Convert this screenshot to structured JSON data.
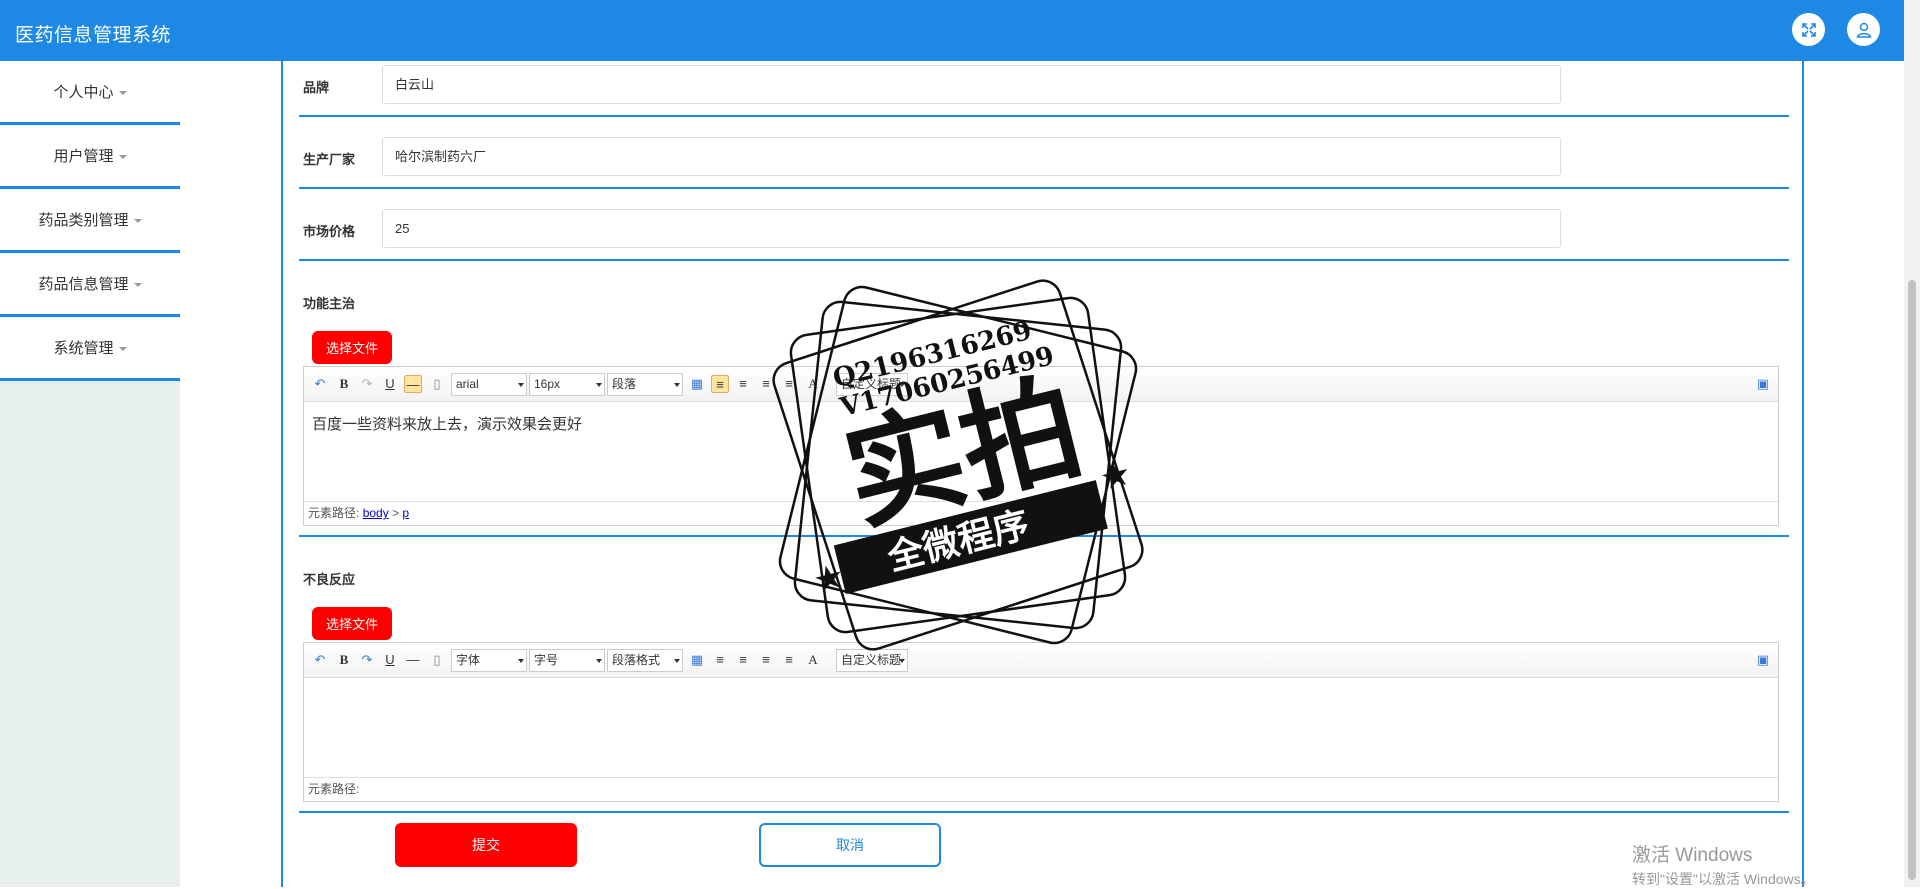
{
  "app": {
    "title": "医药信息管理系统"
  },
  "header": {
    "fullscreen_icon": "fullscreen-icon",
    "user_icon": "user-icon"
  },
  "sidebar": {
    "items": [
      {
        "label": "个人中心"
      },
      {
        "label": "用户管理"
      },
      {
        "label": "药品类别管理"
      },
      {
        "label": "药品信息管理"
      },
      {
        "label": "系统管理"
      }
    ]
  },
  "form": {
    "brand": {
      "label": "品牌",
      "value": "白云山"
    },
    "manufacturer": {
      "label": "生产厂家",
      "value": "哈尔滨制药六厂"
    },
    "price": {
      "label": "市场价格",
      "value": "25"
    },
    "functions": {
      "label": "功能主治",
      "file_button": "选择文件",
      "toolbar": {
        "font": "arial",
        "size": "16px",
        "paragraph": "段落",
        "custom": "自定义标题"
      },
      "content": "百度一些资料来放上去，演示效果会更好",
      "path_label": "元素路径:",
      "path_body": "body",
      "path_sep": ">",
      "path_p": "p"
    },
    "adverse": {
      "label": "不良反应",
      "file_button": "选择文件",
      "toolbar": {
        "font": "字体",
        "size": "字号",
        "paragraph": "段落格式",
        "custom": "自定义标题"
      },
      "content": "",
      "path_label": "元素路径:"
    },
    "submit": "提交",
    "cancel": "取消"
  },
  "watermark": {
    "line1": "Q2196316269",
    "line2": "V17060256499",
    "big": "实拍",
    "ribbon": "全微程序"
  },
  "windows_activation": {
    "title": "激活 Windows",
    "subtitle": "转到\"设置\"以激活 Windows。"
  },
  "colors": {
    "primary": "#1e88e5",
    "danger": "#ff0000"
  }
}
